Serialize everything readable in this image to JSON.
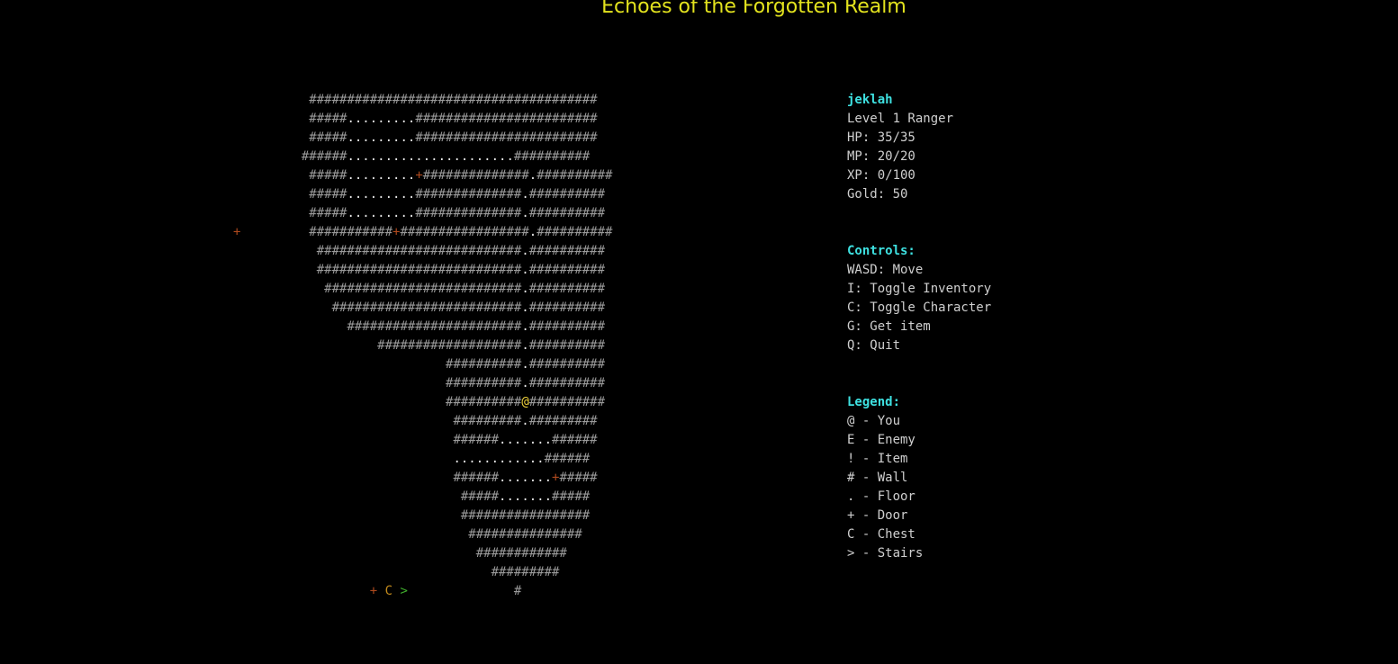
{
  "title": "Echoes of the Forgotten Realm",
  "colors": {
    "title": "#e2e21e",
    "heading": "#3ee0e0",
    "wall": "#9a9a9a",
    "floor": "#e8e8e8",
    "door": "#b04a1e",
    "player": "#f0d23a",
    "chest": "#c28a1c",
    "stairs": "#3fae2c",
    "background": "#000000"
  },
  "map": {
    "rows": [
      "          ######################################",
      "          #####.........########################",
      "          #####.........########################",
      "         ######......................##########",
      "          #####.........+##############.##########",
      "          #####.........##############.##########",
      "          #####.........##############.##########",
      "+         ###########+#################.##########",
      "           ###########################.##########",
      "           ###########################.##########",
      "            ##########################.##########",
      "             #########################.##########",
      "               #######################.##########",
      "                   ###################.##########",
      "                            ##########.##########",
      "                            ##########.##########",
      "                            ##########@##########",
      "                             #########.#########",
      "                             ######.......######",
      "                             ............######",
      "                             ######.......+#####",
      "                              #####.......#####",
      "                              #################",
      "                               ###############",
      "                                ############",
      "                                  #########",
      "                  + C >              #"
    ]
  },
  "character": {
    "name": "jeklah",
    "level_class": "Level 1 Ranger",
    "hp": "HP: 35/35",
    "mp": "MP: 20/20",
    "xp": "XP: 0/100",
    "gold": "Gold: 50"
  },
  "controls": {
    "heading": "Controls:",
    "items": [
      "WASD: Move",
      "I: Toggle Inventory",
      "C: Toggle Character",
      "G: Get item",
      "Q: Quit"
    ]
  },
  "legend": {
    "heading": "Legend:",
    "items": [
      "@ - You",
      "E - Enemy",
      "! - Item",
      "# - Wall",
      ". - Floor",
      "+ - Door",
      "C - Chest",
      "> - Stairs"
    ]
  }
}
